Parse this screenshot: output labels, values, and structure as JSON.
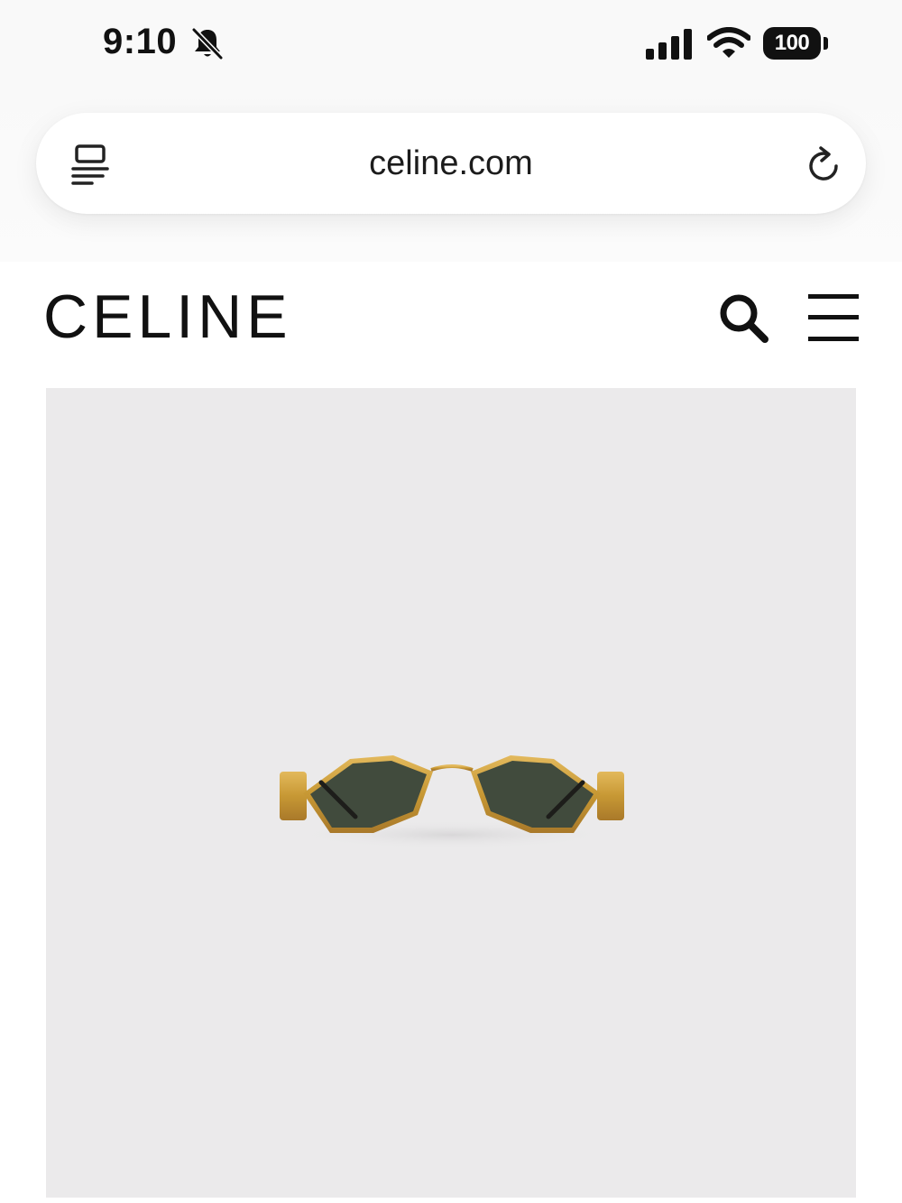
{
  "status_bar": {
    "time": "9:10",
    "battery": "100",
    "icons": [
      "bell-slash-icon",
      "cellular-signal-icon",
      "wifi-icon",
      "battery-icon"
    ]
  },
  "browser": {
    "url": "celine.com",
    "icons": [
      "reader-mode-icon",
      "reload-icon"
    ]
  },
  "site_header": {
    "brand": "CELINE",
    "icons": [
      "search-icon",
      "hamburger-menu-icon"
    ]
  },
  "product": {
    "image": "gold-metal-frame-sunglasses-green-lenses",
    "colors": {
      "background": "#ebeaeb",
      "frame": "#c99a3d",
      "lens": "#414b3d"
    }
  }
}
